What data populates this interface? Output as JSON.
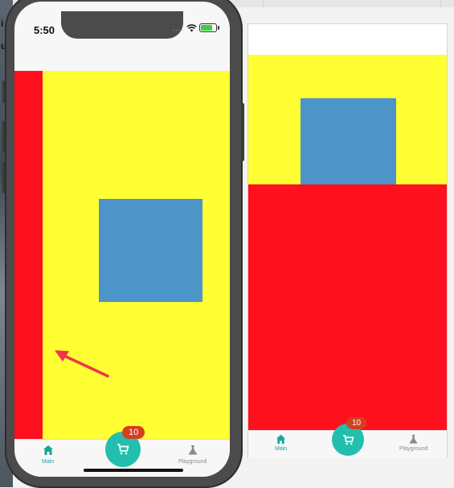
{
  "status_bar": {
    "time": "5:50",
    "signal": "....",
    "battery": "charging"
  },
  "tabbar": {
    "main_label": "Main",
    "playground_label": "Playground",
    "cart_badge": "10"
  },
  "icons": {
    "home": "home-icon",
    "cart": "cart-icon",
    "flask": "flask-icon",
    "wifi": "wifi-icon",
    "battery": "battery-icon",
    "arrow": "annotation-arrow"
  },
  "colors": {
    "red": "#ff101f",
    "yellow": "#ffff33",
    "blue": "#4d94c9",
    "accent": "#1aa39a",
    "fab": "#22bfae",
    "badge": "#d4401f"
  },
  "left_glyphs": [
    "i",
    "u"
  ]
}
